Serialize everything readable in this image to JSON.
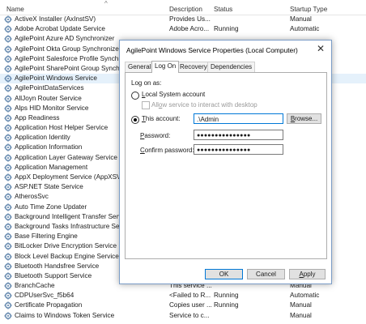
{
  "columns": {
    "name": "Name",
    "description": "Description",
    "status": "Status",
    "startup_type": "Startup Type",
    "sort_glyph": "^"
  },
  "services": [
    {
      "name": "ActiveX Installer (AxInstSV)",
      "description": "Provides Us...",
      "status": "",
      "startup": "Manual"
    },
    {
      "name": "Adobe Acrobat Update Service",
      "description": "Adobe Acro...",
      "status": "Running",
      "startup": "Automatic"
    },
    {
      "name": "AgilePoint Azure AD Synchronizer",
      "description": "",
      "status": "",
      "startup": ""
    },
    {
      "name": "AgilePoint Okta Group Synchronizer",
      "description": "",
      "status": "",
      "startup": ""
    },
    {
      "name": "AgilePoint Salesforce Profile Synchron",
      "description": "",
      "status": "",
      "startup": ""
    },
    {
      "name": "AgilePoint SharePoint Group Synchro",
      "description": "",
      "status": "",
      "startup": ""
    },
    {
      "name": "AgilePoint Windows Service",
      "description": "",
      "status": "",
      "startup": ""
    },
    {
      "name": "AgilePointDataServices",
      "description": "",
      "status": "",
      "startup": ""
    },
    {
      "name": "AllJoyn Router Service",
      "description": "",
      "status": "",
      "startup": "er Start)"
    },
    {
      "name": "Alps HID Monitor Service",
      "description": "",
      "status": "",
      "startup": ""
    },
    {
      "name": "App Readiness",
      "description": "",
      "status": "",
      "startup": ""
    },
    {
      "name": "Application Host Helper Service",
      "description": "",
      "status": "",
      "startup": ""
    },
    {
      "name": "Application Identity",
      "description": "",
      "status": "",
      "startup": "er Start)"
    },
    {
      "name": "Application Information",
      "description": "",
      "status": "",
      "startup": "er Start)"
    },
    {
      "name": "Application Layer Gateway Service",
      "description": "",
      "status": "",
      "startup": ""
    },
    {
      "name": "Application Management",
      "description": "",
      "status": "",
      "startup": ""
    },
    {
      "name": "AppX Deployment Service (AppXSVC)",
      "description": "",
      "status": "",
      "startup": "er Start)"
    },
    {
      "name": "ASP.NET State Service",
      "description": "",
      "status": "",
      "startup": ""
    },
    {
      "name": "AtherosSvc",
      "description": "",
      "status": "",
      "startup": ""
    },
    {
      "name": "Auto Time Zone Updater",
      "description": "",
      "status": "",
      "startup": ""
    },
    {
      "name": "Background Intelligent Transfer Servic",
      "description": "",
      "status": "",
      "startup": "layed Start)"
    },
    {
      "name": "Background Tasks Infrastructure Servic",
      "description": "",
      "status": "",
      "startup": ""
    },
    {
      "name": "Base Filtering Engine",
      "description": "",
      "status": "",
      "startup": ""
    },
    {
      "name": "BitLocker Drive Encryption Service",
      "description": "",
      "status": "",
      "startup": "er Start)"
    },
    {
      "name": "Block Level Backup Engine Service",
      "description": "",
      "status": "",
      "startup": ""
    },
    {
      "name": "Bluetooth Handsfree Service",
      "description": "",
      "status": "",
      "startup": "er Start)"
    },
    {
      "name": "Bluetooth Support Service",
      "description": "",
      "status": "",
      "startup": "er Start)"
    },
    {
      "name": "BranchCache",
      "description": "This service ...",
      "status": "",
      "startup": "Manual"
    },
    {
      "name": "CDPUserSvc_f5b64",
      "description": "<Failed to R...",
      "status": "Running",
      "startup": "Automatic"
    },
    {
      "name": "Certificate Propagation",
      "description": "Copies user ...",
      "status": "Running",
      "startup": "Manual"
    },
    {
      "name": "Claims to Windows Token Service",
      "description": "Service to c...",
      "status": "",
      "startup": "Manual"
    }
  ],
  "selected_index": 6,
  "dialog": {
    "title": "AgilePoint Windows Service Properties (Local Computer)",
    "close_glyph": "✕",
    "tabs": [
      "General",
      "Log On",
      "Recovery",
      "Dependencies"
    ],
    "active_tab": 1,
    "log_on_as": "Log on as:",
    "local_system_pre": "",
    "local_system_acc": "L",
    "local_system_post": "ocal System account",
    "allow_interact_pre": "All",
    "allow_interact_acc": "o",
    "allow_interact_post": "w service to interact with desktop",
    "this_account_pre": "",
    "this_account_acc": "T",
    "this_account_post": "his account:",
    "account_value": ".\\Admin",
    "browse_pre": "",
    "browse_acc": "B",
    "browse_post": "rowse...",
    "password_pre": "",
    "password_acc": "P",
    "password_post": "assword:",
    "password_value": "●●●●●●●●●●●●●●●",
    "confirm_pre": "",
    "confirm_acc": "C",
    "confirm_post": "onfirm password:",
    "confirm_value": "●●●●●●●●●●●●●●●",
    "ok_label": "OK",
    "cancel_label": "Cancel",
    "apply_pre": "",
    "apply_acc": "A",
    "apply_post": "pply"
  },
  "colors": {
    "selection": "#e5f1fb",
    "focus_border": "#0078d7",
    "icon_gear": "#6d8fb3"
  }
}
